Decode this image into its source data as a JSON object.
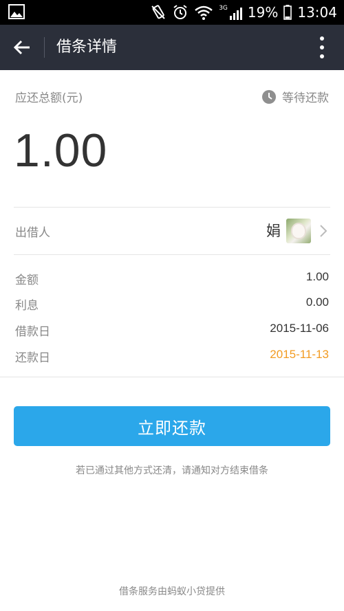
{
  "status_bar": {
    "network": "3G",
    "battery": "19%",
    "time": "13:04"
  },
  "app_bar": {
    "title": "借条详情"
  },
  "summary": {
    "total_label": "应还总额(元)",
    "status": "等待还款",
    "amount": "1.00"
  },
  "lender": {
    "label": "出借人",
    "name": "娟"
  },
  "details": [
    {
      "key": "金额",
      "value": "1.00"
    },
    {
      "key": "利息",
      "value": "0.00"
    },
    {
      "key": "借款日",
      "value": "2015-11-06"
    },
    {
      "key": "还款日",
      "value": "2015-11-13"
    }
  ],
  "actions": {
    "pay_label": "立即还款",
    "hint": "若已通过其他方式还清，请通知对方结束借条"
  },
  "footer": {
    "text": "借条服务由蚂蚁小贷提供"
  },
  "colors": {
    "app_bar": "#2b2f3a",
    "primary_button": "#2ba7ea",
    "due_date": "#f29b21"
  }
}
